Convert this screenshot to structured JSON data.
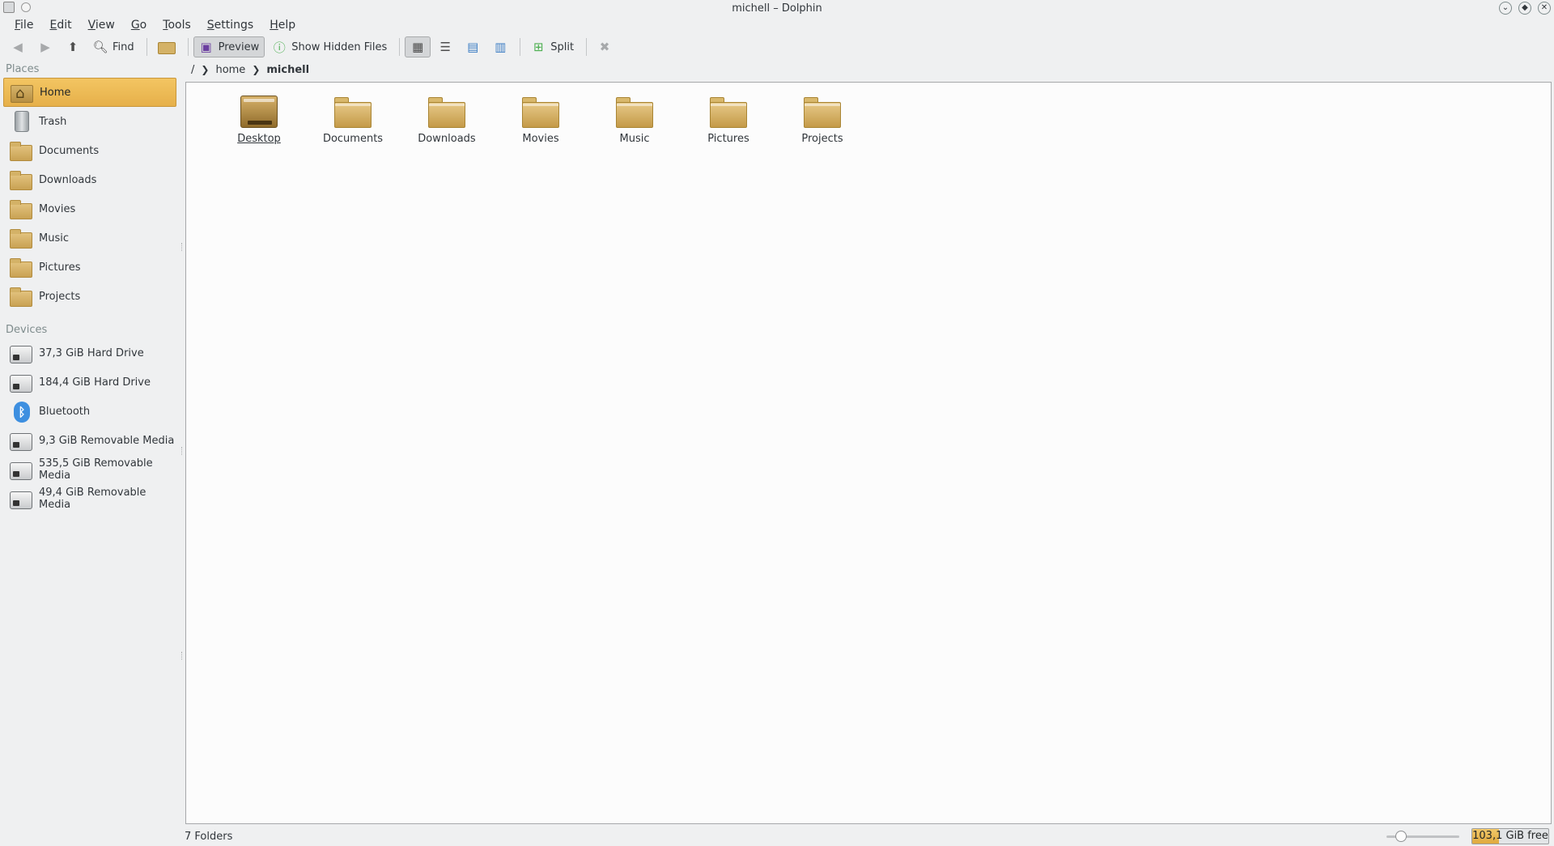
{
  "window": {
    "title": "michell – Dolphin"
  },
  "menu": {
    "items": [
      {
        "label": "File",
        "underline": "F",
        "rest": "ile"
      },
      {
        "label": "Edit",
        "underline": "E",
        "rest": "dit"
      },
      {
        "label": "View",
        "underline": "V",
        "rest": "iew"
      },
      {
        "label": "Go",
        "underline": "G",
        "rest": "o"
      },
      {
        "label": "Tools",
        "underline": "T",
        "rest": "ools"
      },
      {
        "label": "Settings",
        "underline": "S",
        "rest": "ettings"
      },
      {
        "label": "Help",
        "underline": "H",
        "rest": "elp"
      }
    ]
  },
  "toolbar": {
    "find_label": "Find",
    "preview_label": "Preview",
    "hidden_label": "Show Hidden Files",
    "split_label": "Split"
  },
  "sidebar": {
    "places_label": "Places",
    "places": [
      {
        "label": "Home",
        "icon": "home-folder-icon",
        "active": true
      },
      {
        "label": "Trash",
        "icon": "trash-icon"
      },
      {
        "label": "Documents",
        "icon": "folder-icon"
      },
      {
        "label": "Downloads",
        "icon": "folder-icon"
      },
      {
        "label": "Movies",
        "icon": "folder-icon"
      },
      {
        "label": "Music",
        "icon": "folder-icon"
      },
      {
        "label": "Pictures",
        "icon": "folder-icon"
      },
      {
        "label": "Projects",
        "icon": "folder-icon"
      }
    ],
    "devices_label": "Devices",
    "devices": [
      {
        "label": "37,3 GiB Hard Drive",
        "icon": "hard-drive-icon"
      },
      {
        "label": "184,4 GiB Hard Drive",
        "icon": "hard-drive-icon"
      },
      {
        "label": "Bluetooth",
        "icon": "bluetooth-icon"
      },
      {
        "label": "9,3 GiB Removable Media",
        "icon": "removable-media-icon"
      },
      {
        "label": "535,5 GiB Removable Media",
        "icon": "removable-media-icon"
      },
      {
        "label": "49,4 GiB Removable Media",
        "icon": "removable-media-icon"
      }
    ]
  },
  "breadcrumb": {
    "root": "/",
    "items": [
      "home",
      "michell"
    ]
  },
  "files": [
    {
      "label": "Desktop",
      "type": "desktop"
    },
    {
      "label": "Documents",
      "type": "folder"
    },
    {
      "label": "Downloads",
      "type": "folder"
    },
    {
      "label": "Movies",
      "type": "folder"
    },
    {
      "label": "Music",
      "type": "folder"
    },
    {
      "label": "Pictures",
      "type": "folder"
    },
    {
      "label": "Projects",
      "type": "folder"
    }
  ],
  "status": {
    "summary": "7 Folders",
    "free_space": "103,1 GiB free",
    "used_fraction": 0.35,
    "zoom_fraction": 0.2
  },
  "colors": {
    "accent": "#e6b04a",
    "folder": "#d4b267"
  }
}
